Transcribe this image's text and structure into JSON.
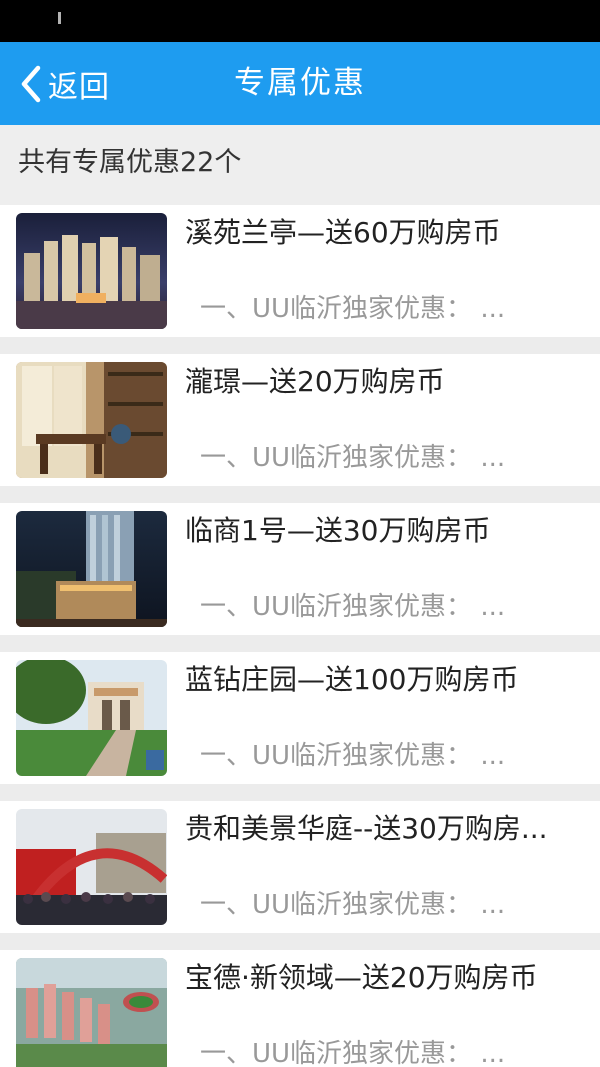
{
  "nav": {
    "back_label": "返回",
    "title": "专属优惠"
  },
  "summary": {
    "text": "共有专属优惠22个"
  },
  "colors": {
    "nav_bg": "#1e9cf0",
    "summary_bg": "#eeeeee",
    "desc_text": "#999999"
  },
  "items": [
    {
      "title": "溪苑兰亭—送60万购房币",
      "desc": "一、UU临沂独家优惠： ...",
      "image": "night-cityscape-image"
    },
    {
      "title": "瀧璟—送20万购房币",
      "desc": "一、UU临沂独家优惠： ...",
      "image": "study-room-interior-image"
    },
    {
      "title": "临商1号—送30万购房币",
      "desc": "一、UU临沂独家优惠： ...",
      "image": "night-tower-building-image"
    },
    {
      "title": "蓝钻庄园—送100万购房币",
      "desc": "一、UU临沂独家优惠： ...",
      "image": "garden-villa-entrance-image"
    },
    {
      "title": "贵和美景华庭--送30万购房...",
      "desc": "一、UU临沂独家优惠： ...",
      "image": "crowd-event-arch-image"
    },
    {
      "title": "宝德·新领域—送20万购房币",
      "desc": "一、UU临沂独家优惠： ...",
      "image": "aerial-residential-render-image"
    }
  ]
}
